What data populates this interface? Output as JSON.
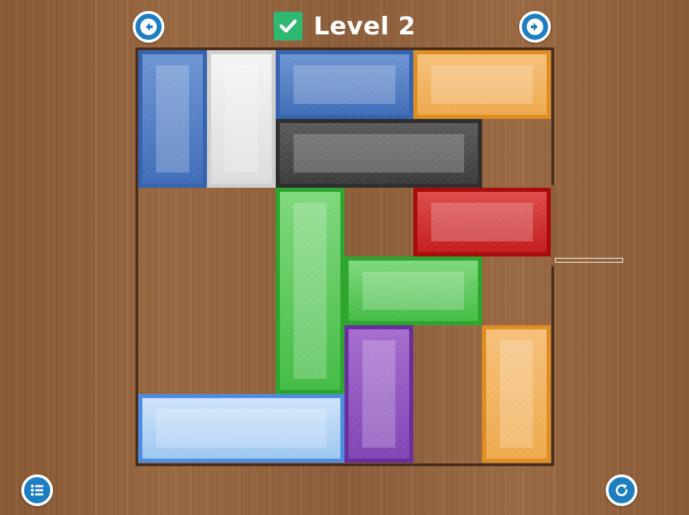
{
  "header": {
    "title": "Level 2",
    "completed": true,
    "check_color": "#2eb872",
    "prev_icon": "arrow-left-icon",
    "next_icon": "arrow-right-icon"
  },
  "footer": {
    "menu_icon": "list-menu-icon",
    "restart_icon": "restart-icon"
  },
  "board": {
    "grid_size": 6,
    "exit_row": 3,
    "exit_side": "right",
    "border_color": "#4a2e1d",
    "blocks": [
      {
        "id": "blue-vertical",
        "color": "blue",
        "hex": "#3f6cb8",
        "col": 1,
        "row": 1,
        "w": 1,
        "h": 2
      },
      {
        "id": "white-vertical",
        "color": "white",
        "hex": "#e6e6e6",
        "col": 2,
        "row": 1,
        "w": 1,
        "h": 2
      },
      {
        "id": "blue-horizontal",
        "color": "blue",
        "hex": "#3f6cb8",
        "col": 3,
        "row": 1,
        "w": 2,
        "h": 1
      },
      {
        "id": "orange-horizontal",
        "color": "orange",
        "hex": "#eea94c",
        "col": 5,
        "row": 1,
        "w": 2,
        "h": 1
      },
      {
        "id": "gray-horizontal",
        "color": "gray",
        "hex": "#3c3c3c",
        "col": 3,
        "row": 2,
        "w": 3,
        "h": 1
      },
      {
        "id": "red-target",
        "color": "red",
        "hex": "#c21c1c",
        "col": 5,
        "row": 3,
        "w": 2,
        "h": 1
      },
      {
        "id": "green-vertical",
        "color": "green",
        "hex": "#42bb43",
        "col": 3,
        "row": 3,
        "w": 1,
        "h": 3
      },
      {
        "id": "green-horizontal",
        "color": "green",
        "hex": "#42bb43",
        "col": 4,
        "row": 4,
        "w": 2,
        "h": 1
      },
      {
        "id": "purple-vertical",
        "color": "purple",
        "hex": "#8043b4",
        "col": 4,
        "row": 5,
        "w": 1,
        "h": 2
      },
      {
        "id": "orange-vertical",
        "color": "orange",
        "hex": "#eea94c",
        "col": 6,
        "row": 5,
        "w": 1,
        "h": 2
      },
      {
        "id": "lightblue-horizontal",
        "color": "lightblue",
        "hex": "#9cc6f1",
        "col": 1,
        "row": 6,
        "w": 3,
        "h": 1
      }
    ]
  }
}
